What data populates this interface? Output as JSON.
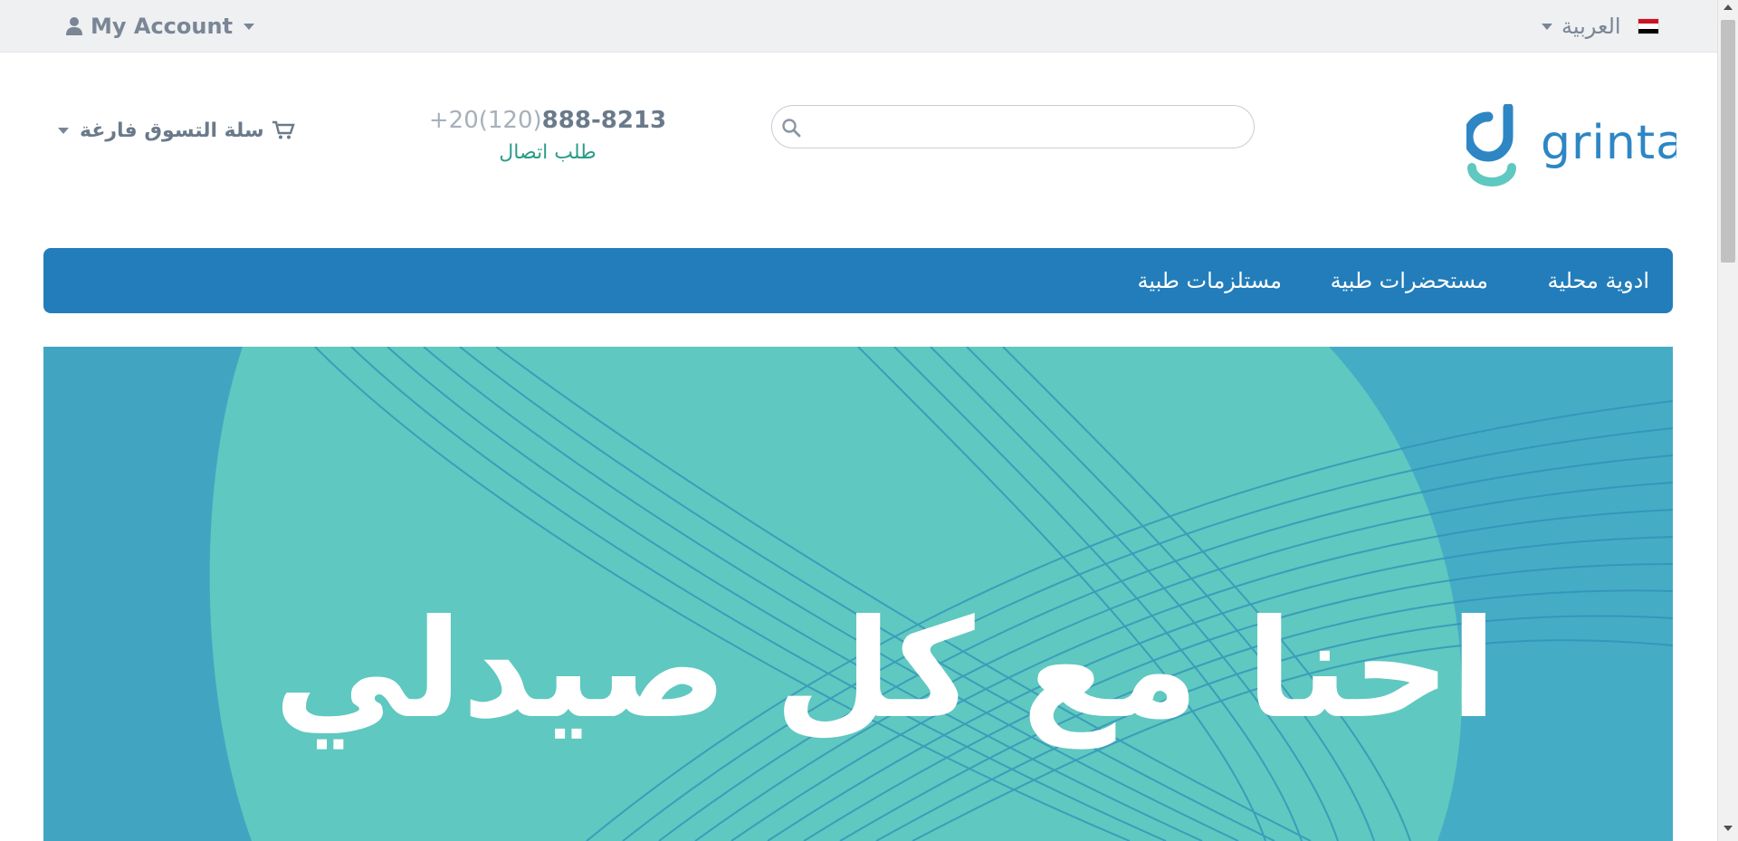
{
  "topbar": {
    "account_label": "My Account",
    "language_label": "العربية",
    "flag_colors": [
      "#ce1126",
      "#ffffff",
      "#000000"
    ]
  },
  "header": {
    "logo_text": "grinta",
    "search": {
      "placeholder": "",
      "value": ""
    },
    "phone_prefix": "+20(120)",
    "phone_number": "888-8213",
    "call_request_label": "طلب اتصال",
    "cart_label": "سلة التسوق فارغة"
  },
  "nav": {
    "items": [
      {
        "label": "ادوية محلية"
      },
      {
        "label": "مستحضرات طبية"
      },
      {
        "label": "مستلزمات طبية"
      }
    ]
  },
  "banner": {
    "headline": "احنا مع كل صيدلي"
  },
  "colors": {
    "nav_bg": "#227dba",
    "banner_bg": "#5fc8c0",
    "banner_lines": "#2f8fb8",
    "logo_blue": "#2e86c4",
    "logo_teal": "#5fc8c0",
    "call_link": "#2a9c88"
  },
  "icons": {
    "account": "user-icon",
    "cart": "cart-icon",
    "search": "search-icon",
    "scroll_up": "arrow-up-icon",
    "scroll_down": "arrow-down-icon"
  }
}
